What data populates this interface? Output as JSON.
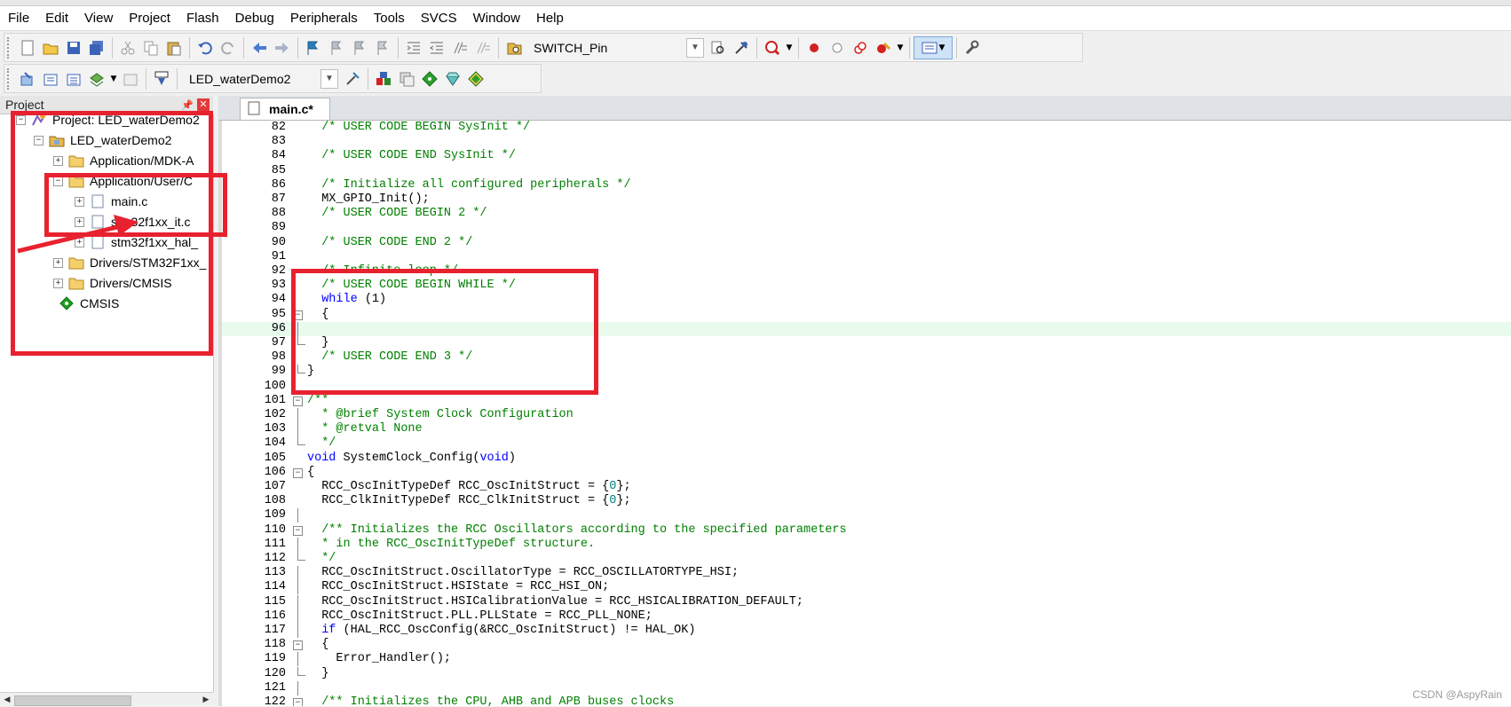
{
  "menu": [
    "File",
    "Edit",
    "View",
    "Project",
    "Flash",
    "Debug",
    "Peripherals",
    "Tools",
    "SVCS",
    "Window",
    "Help"
  ],
  "toolbar1": {
    "find_combo_value": "SWITCH_Pin"
  },
  "toolbar2": {
    "target_combo_value": "LED_waterDemo2"
  },
  "project_panel": {
    "title": "Project",
    "tree": [
      {
        "label": "Project: LED_waterDemo2",
        "expander": "⊟",
        "icon": "project-icon"
      },
      {
        "label": "LED_waterDemo2",
        "expander": "⊟",
        "icon": "target-icon"
      },
      {
        "label": "Application/MDK-A",
        "expander": "⊞",
        "icon": "folder-icon"
      },
      {
        "label": "Application/User/C",
        "expander": "⊟",
        "icon": "folder-icon"
      },
      {
        "label": "main.c",
        "expander": "⊞",
        "icon": "file-icon"
      },
      {
        "label": "stm32f1xx_it.c",
        "expander": "⊞",
        "icon": "file-icon"
      },
      {
        "label": "stm32f1xx_hal_",
        "expander": "⊞",
        "icon": "file-icon"
      },
      {
        "label": "Drivers/STM32F1xx_",
        "expander": "⊞",
        "icon": "folder-icon"
      },
      {
        "label": "Drivers/CMSIS",
        "expander": "⊞",
        "icon": "folder-icon"
      },
      {
        "label": "CMSIS",
        "expander": "",
        "icon": "cmsis-diamond-icon"
      }
    ]
  },
  "editor": {
    "tab_label": "main.c*",
    "lines": [
      {
        "n": "82",
        "t": "  /* USER CODE BEGIN SysInit */",
        "c": "comment"
      },
      {
        "n": "83",
        "t": "",
        "c": "plain"
      },
      {
        "n": "84",
        "t": "  /* USER CODE END SysInit */",
        "c": "comment"
      },
      {
        "n": "85",
        "t": "",
        "c": "plain"
      },
      {
        "n": "86",
        "t": "  /* Initialize all configured peripherals */",
        "c": "comment"
      },
      {
        "n": "87",
        "t": "  MX_GPIO_Init();",
        "c": "plain"
      },
      {
        "n": "88",
        "t": "  /* USER CODE BEGIN 2 */",
        "c": "comment"
      },
      {
        "n": "89",
        "t": "",
        "c": "plain"
      },
      {
        "n": "90",
        "t": "  /* USER CODE END 2 */",
        "c": "comment"
      },
      {
        "n": "91",
        "t": "",
        "c": "plain"
      },
      {
        "n": "92",
        "t": "  /* Infinite loop */",
        "c": "comment"
      },
      {
        "n": "93",
        "t": "  /* USER CODE BEGIN WHILE */",
        "c": "comment"
      },
      {
        "n": "94",
        "t": "  while (1)",
        "c": "while"
      },
      {
        "n": "95",
        "t": "  {",
        "c": "plain",
        "fold": "open"
      },
      {
        "n": "96",
        "t": "",
        "c": "plain",
        "hl": true,
        "fold": "line"
      },
      {
        "n": "97",
        "t": "  }",
        "c": "plain",
        "fold": "end"
      },
      {
        "n": "98",
        "t": "  /* USER CODE END 3 */",
        "c": "comment"
      },
      {
        "n": "99",
        "t": "}",
        "c": "plain",
        "fold": "end"
      },
      {
        "n": "100",
        "t": "",
        "c": "plain"
      },
      {
        "n": "101",
        "t": "/**",
        "c": "comment",
        "fold": "open"
      },
      {
        "n": "102",
        "t": "  * @brief System Clock Configuration",
        "c": "comment",
        "fold": "line"
      },
      {
        "n": "103",
        "t": "  * @retval None",
        "c": "comment",
        "fold": "line"
      },
      {
        "n": "104",
        "t": "  */",
        "c": "comment",
        "fold": "end"
      },
      {
        "n": "105",
        "t": "void SystemClock_Config(void)",
        "c": "void"
      },
      {
        "n": "106",
        "t": "{",
        "c": "plain",
        "fold": "open"
      },
      {
        "n": "107",
        "t": "  RCC_OscInitTypeDef RCC_OscInitStruct = {0};",
        "c": "zero"
      },
      {
        "n": "108",
        "t": "  RCC_ClkInitTypeDef RCC_ClkInitStruct = {0};",
        "c": "zero"
      },
      {
        "n": "109",
        "t": "",
        "c": "plain",
        "fold": "line"
      },
      {
        "n": "110",
        "t": "  /** Initializes the RCC Oscillators according to the specified parameters",
        "c": "comment",
        "fold": "open"
      },
      {
        "n": "111",
        "t": "  * in the RCC_OscInitTypeDef structure.",
        "c": "comment",
        "fold": "line"
      },
      {
        "n": "112",
        "t": "  */",
        "c": "comment",
        "fold": "end"
      },
      {
        "n": "113",
        "t": "  RCC_OscInitStruct.OscillatorType = RCC_OSCILLATORTYPE_HSI;",
        "c": "plain",
        "fold": "line"
      },
      {
        "n": "114",
        "t": "  RCC_OscInitStruct.HSIState = RCC_HSI_ON;",
        "c": "plain",
        "fold": "line"
      },
      {
        "n": "115",
        "t": "  RCC_OscInitStruct.HSICalibrationValue = RCC_HSICALIBRATION_DEFAULT;",
        "c": "plain",
        "fold": "line"
      },
      {
        "n": "116",
        "t": "  RCC_OscInitStruct.PLL.PLLState = RCC_PLL_NONE;",
        "c": "plain",
        "fold": "line"
      },
      {
        "n": "117",
        "t": "  if (HAL_RCC_OscConfig(&RCC_OscInitStruct) != HAL_OK)",
        "c": "if",
        "fold": "line"
      },
      {
        "n": "118",
        "t": "  {",
        "c": "plain",
        "fold": "open"
      },
      {
        "n": "119",
        "t": "    Error_Handler();",
        "c": "plain",
        "fold": "line"
      },
      {
        "n": "120",
        "t": "  }",
        "c": "plain",
        "fold": "end"
      },
      {
        "n": "121",
        "t": "",
        "c": "plain",
        "fold": "line"
      },
      {
        "n": "122",
        "t": "  /** Initializes the CPU, AHB and APB buses clocks",
        "c": "comment",
        "fold": "open"
      }
    ]
  },
  "watermark": "CSDN @AspyRain",
  "colors": {
    "annotation_red": "#e8212f",
    "comment_green": "#008000",
    "keyword_blue": "#0000ff"
  }
}
